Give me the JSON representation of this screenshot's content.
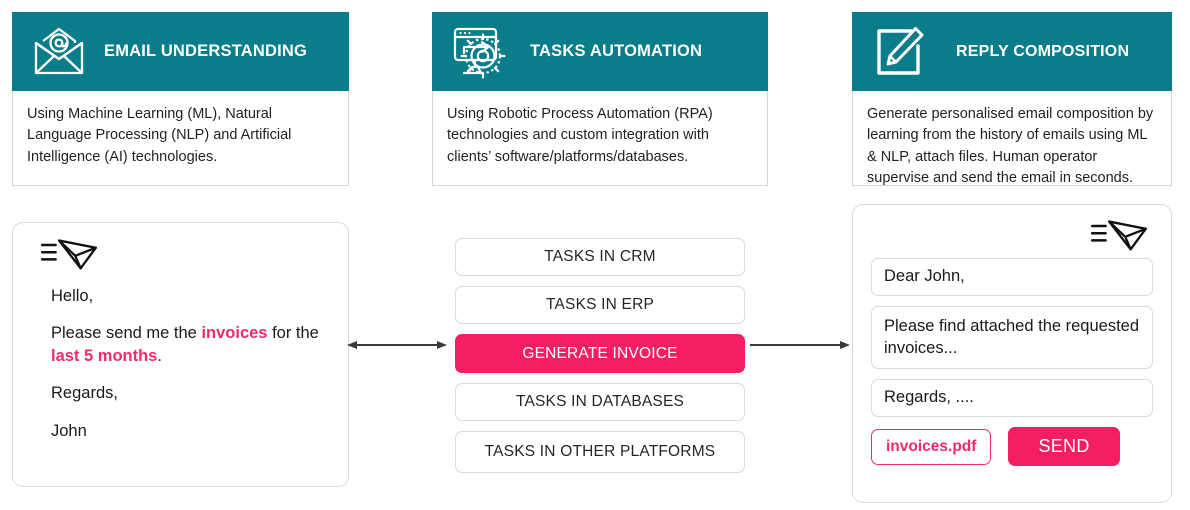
{
  "panels": [
    {
      "icon": "email-at-envelope-icon",
      "title": "EMAIL UNDERSTANDING",
      "description": "Using Machine Learning (ML), Natural Language Processing (NLP) and Artificial Intelligence  (AI) technologies."
    },
    {
      "icon": "monitor-gear-automation-icon",
      "title": "TASKS AUTOMATION",
      "description": "Using Robotic Process Automation (RPA) technologies and custom integration with clients’ software/platforms/databases."
    },
    {
      "icon": "pencil-compose-icon",
      "title": "REPLY COMPOSITION",
      "description": "Generate personalised email composition by learning from the history of emails using ML & NLP, attach files. Human  operator supervise and send the email in seconds."
    }
  ],
  "incoming_email": {
    "icon": "incoming-mail-icon",
    "greeting": "Hello,",
    "body_prefix": "Please send me the ",
    "body_highlight_1": "invoices",
    "body_middle": " for the ",
    "body_highlight_2": "last 5 months",
    "body_suffix": ".",
    "signoff": "Regards,",
    "sender": "John"
  },
  "tasks": [
    {
      "label": "TASKS IN CRM",
      "active": false
    },
    {
      "label": "TASKS IN ERP",
      "active": false
    },
    {
      "label": "GENERATE INVOICE",
      "active": true
    },
    {
      "label": "TASKS IN DATABASES",
      "active": false
    },
    {
      "label": "TASKS IN OTHER PLATFORMS",
      "active": false
    }
  ],
  "reply_email": {
    "icon": "outgoing-mail-icon",
    "greeting": "Dear John,",
    "body": "Please find attached the requested invoices...",
    "signoff": "Regards, ....",
    "attachment": "invoices.pdf",
    "send_label": "SEND"
  },
  "connectors": {
    "left": "double-headed-arrow",
    "right": "right-arrow"
  },
  "colors": {
    "teal": "#0a7c8a",
    "pink": "#f51e62",
    "pink_text": "#ef2b6d",
    "border": "#d9d9d9",
    "text": "#1a1a1a"
  }
}
